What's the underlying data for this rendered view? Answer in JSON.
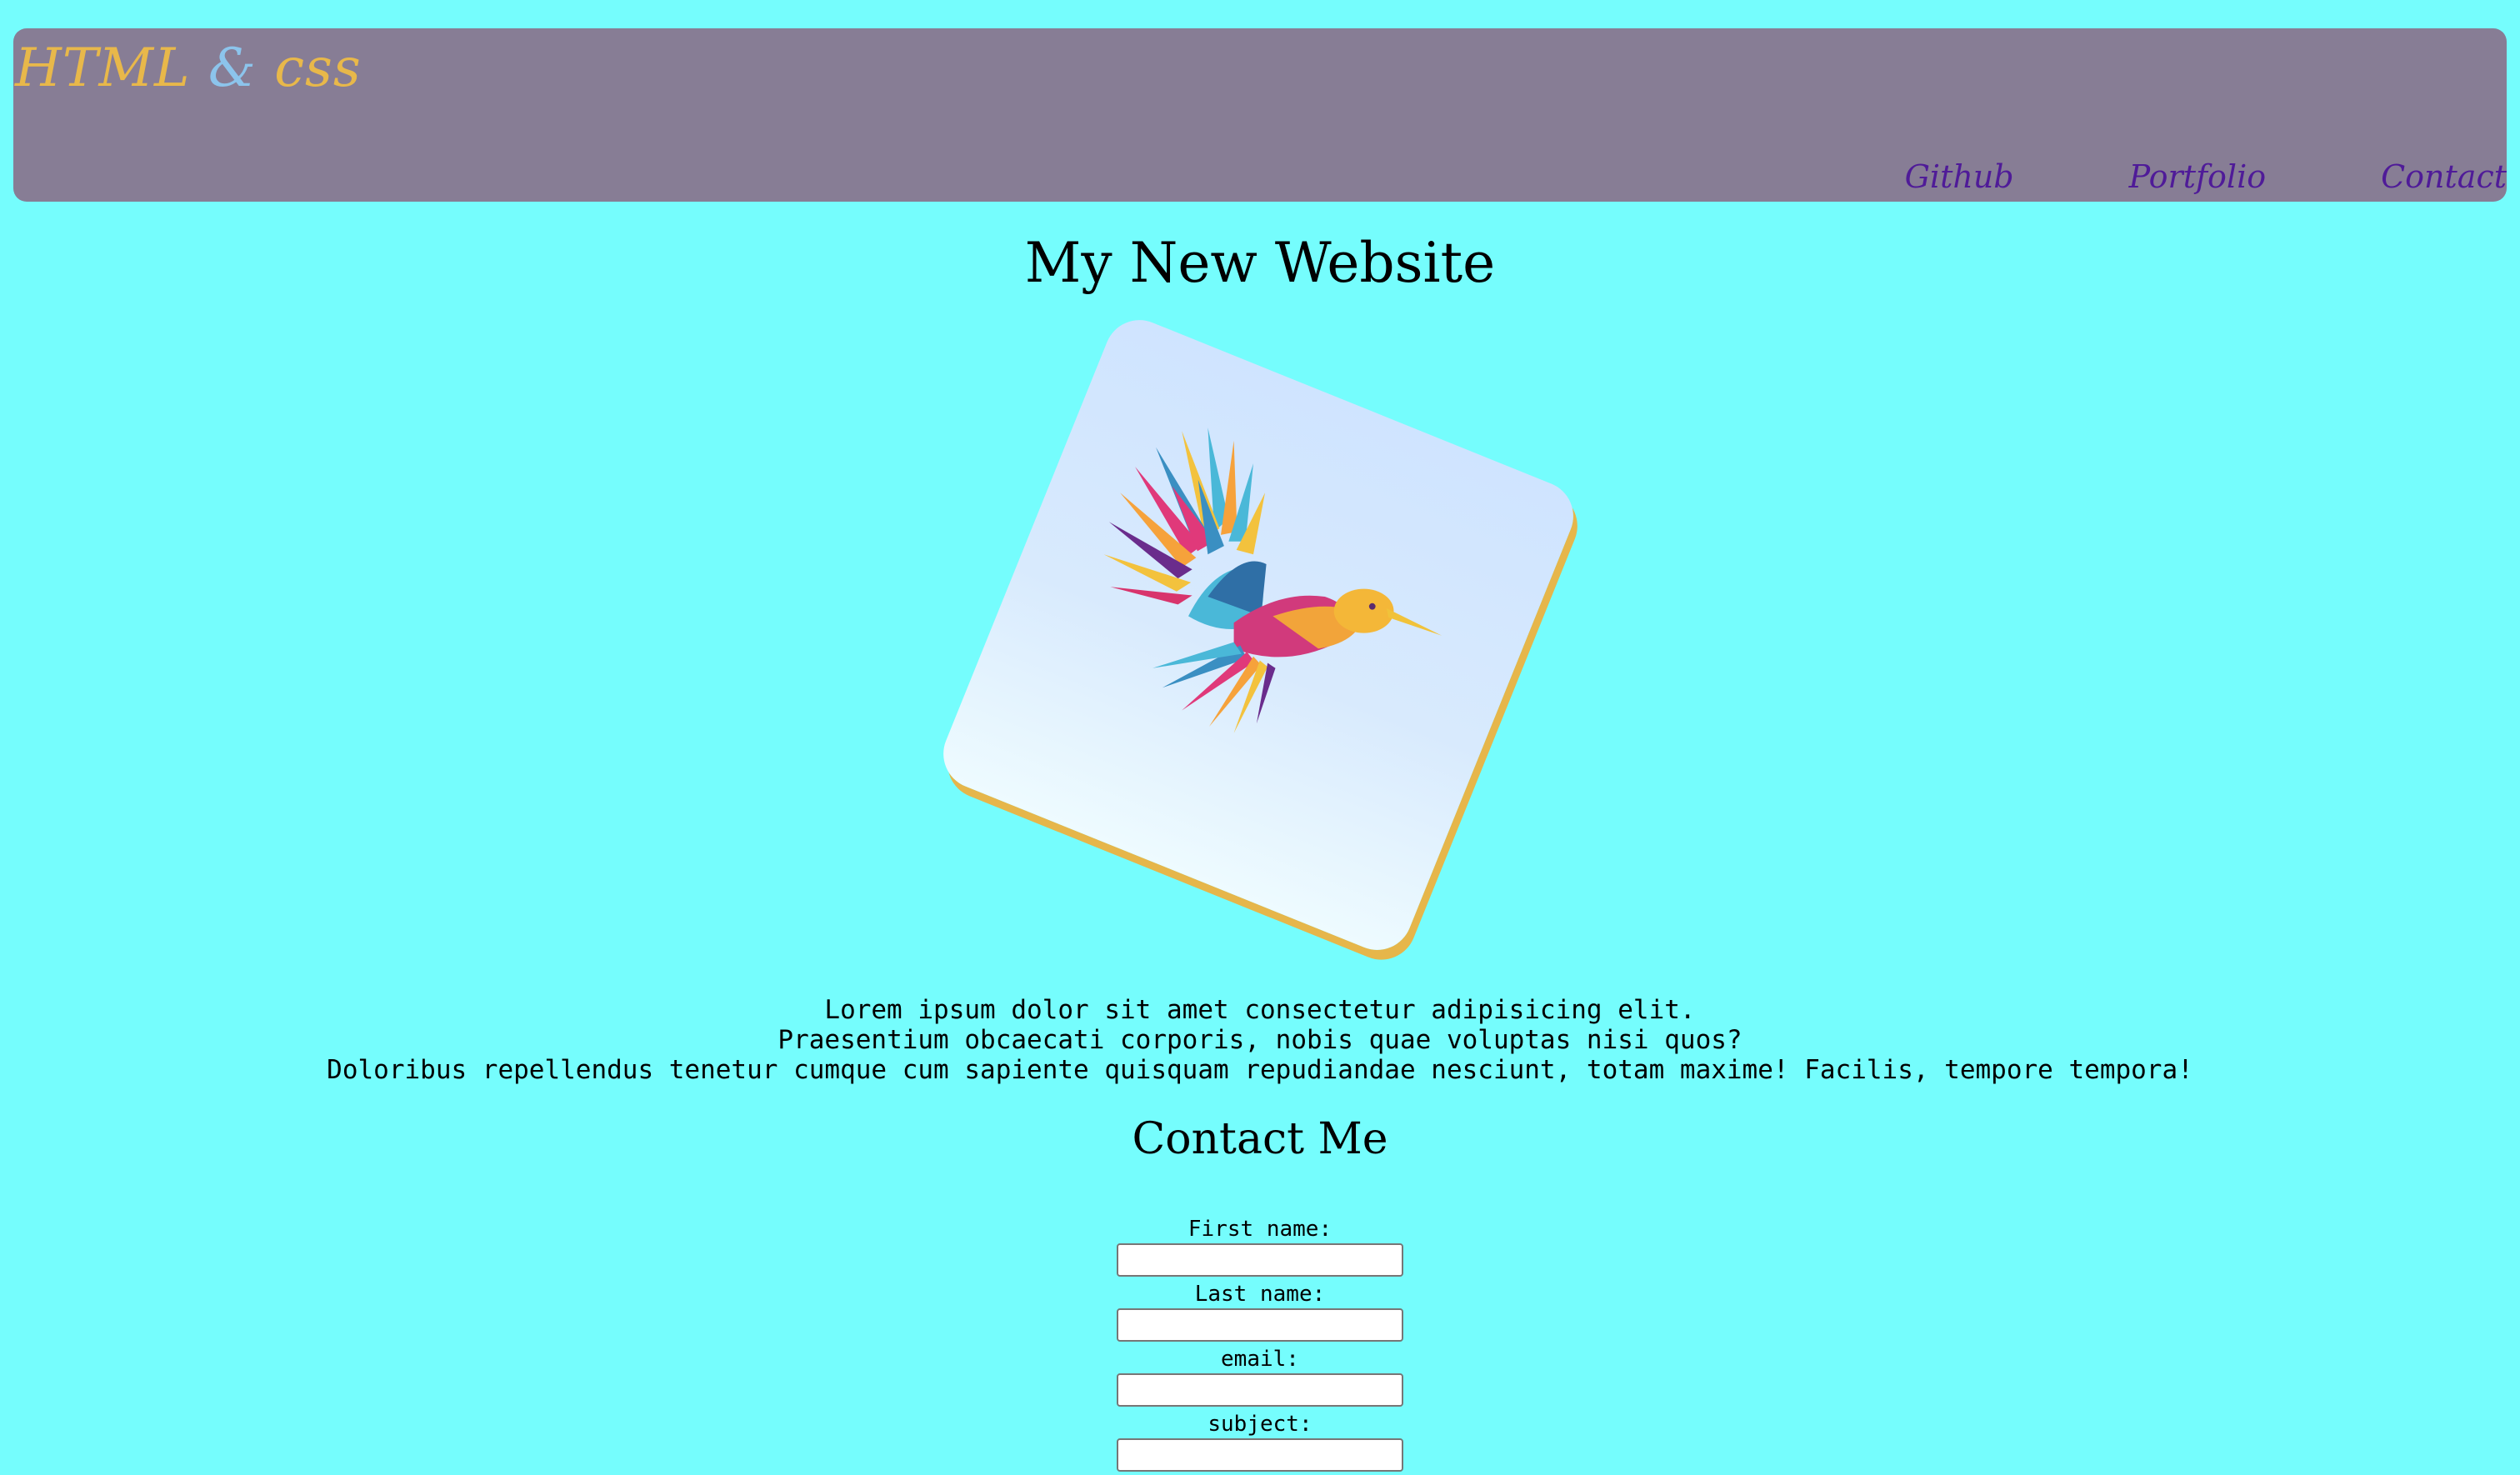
{
  "header": {
    "logo_html": "HTML",
    "logo_amp": "&",
    "logo_css": "css",
    "nav": [
      "Github",
      "Portfolio",
      "Contact"
    ]
  },
  "main": {
    "title": "My New Website",
    "hero_image": "hummingbird-illustration",
    "intro": [
      "Lorem ipsum dolor sit amet consectetur adipisicing elit.",
      "Praesentium obcaecati corporis, nobis quae voluptas nisi quos?",
      "Doloribus repellendus tenetur cumque cum sapiente quisquam repudiandae nesciunt, totam maxime! Facilis, tempore tempora!"
    ]
  },
  "contact": {
    "title": "Contact Me",
    "fields": [
      {
        "label": "First name:",
        "value": ""
      },
      {
        "label": "Last name:",
        "value": ""
      },
      {
        "label": "email:",
        "value": ""
      },
      {
        "label": "subject:",
        "value": ""
      }
    ]
  },
  "colors": {
    "background": "#75fdfd",
    "header": "#877d95",
    "logo": "#e8b84a",
    "logo_amp": "#8cc4ec",
    "nav_link": "#4f1b98",
    "image_border": "#e6b64a"
  }
}
